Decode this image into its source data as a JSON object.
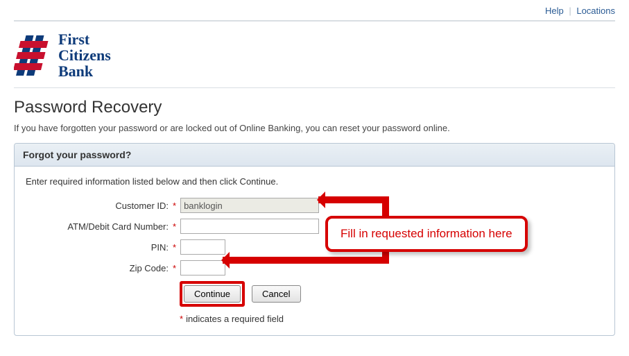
{
  "topNav": {
    "help": "Help",
    "locations": "Locations"
  },
  "brand": {
    "line1": "First",
    "line2": "Citizens",
    "line3": "Bank"
  },
  "page": {
    "title": "Password Recovery",
    "intro": "If you have forgotten your password or are locked out of Online Banking, you can reset your password online."
  },
  "panel": {
    "header": "Forgot your password?",
    "instructions": "Enter required information listed below and then click Continue."
  },
  "form": {
    "customerId": {
      "label": "Customer ID:",
      "value": "banklogin"
    },
    "atmDebit": {
      "label": "ATM/Debit Card Number:",
      "value": ""
    },
    "pin": {
      "label": "PIN:",
      "value": ""
    },
    "zip": {
      "label": "Zip Code:",
      "value": ""
    }
  },
  "buttons": {
    "continue": "Continue",
    "cancel": "Cancel"
  },
  "footnote": "indicates a required field",
  "annotation": {
    "callout": "Fill in requested information here"
  }
}
